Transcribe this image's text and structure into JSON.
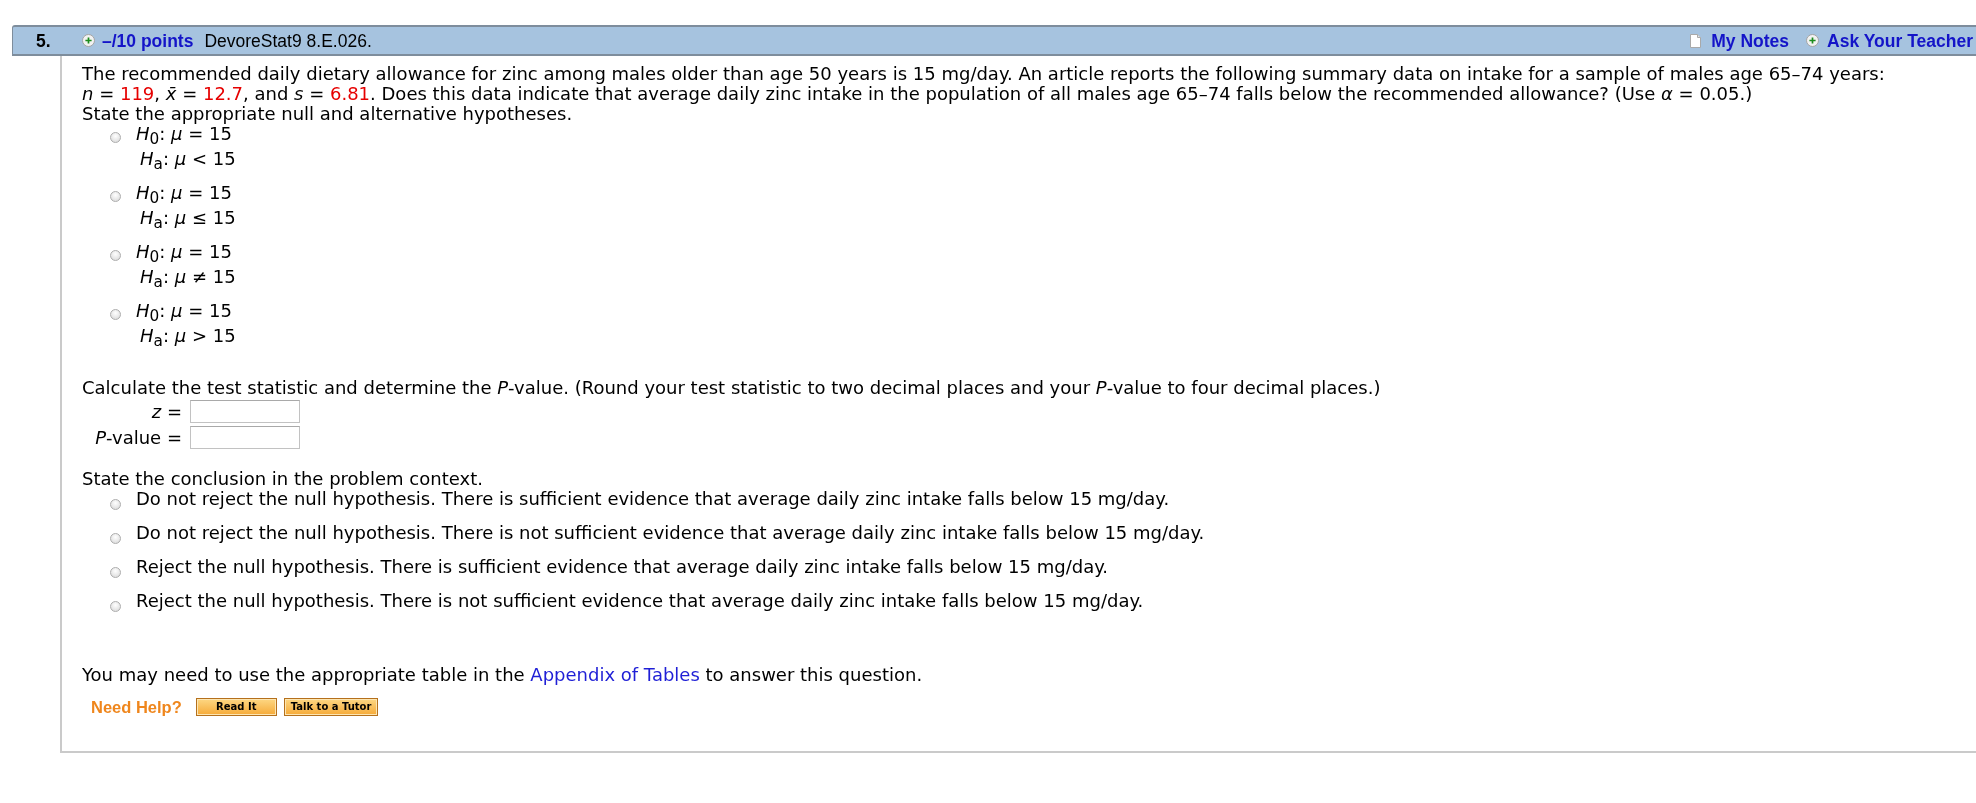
{
  "question": {
    "number": "5.",
    "points": "–/10 points",
    "source": "DevoreStat9 8.E.026.",
    "my_notes": "My Notes",
    "ask_teacher": "Ask Your Teacher"
  },
  "statement": [
    {
      "kind": "plain",
      "text": "The recommended daily dietary allowance for zinc among males older than age 50 years is 15 mg/day. An article reports the following summary data on intake for a sample of males age 65–74 years: *n* = "
    },
    {
      "kind": "given",
      "text": "119"
    },
    {
      "kind": "plain",
      "text": ", *x̄* = "
    },
    {
      "kind": "given",
      "text": "12.7"
    },
    {
      "kind": "plain",
      "text": ", and *s* = "
    },
    {
      "kind": "given",
      "text": "6.81"
    },
    {
      "kind": "plain",
      "text": ". Does this data indicate that average daily zinc intake in the population of all males age 65–74 falls below the recommended allowance? (Use *α* = 0.05.)"
    }
  ],
  "hypotheses": {
    "prompt": "State the appropriate null and alternative hypotheses.",
    "options": [
      {
        "null": "*H*$_{0}$: *μ* = 15",
        "alternative": "*H*$_{a}$: *μ* < 15",
        "selected": false
      },
      {
        "null": "*H*$_{0}$: *μ* = 15",
        "alternative": "*H*$_{a}$: *μ* ≤ 15",
        "selected": false
      },
      {
        "null": "*H*$_{0}$: *μ* = 15",
        "alternative": "*H*$_{a}$: *μ* ≠ 15",
        "selected": false
      },
      {
        "null": "*H*$_{0}$: *μ* = 15",
        "alternative": "*H*$_{a}$: *μ* > 15",
        "selected": false
      }
    ]
  },
  "test_statistic": {
    "prompt": "Calculate the test statistic and determine the *P*-value. (Round your test statistic to two decimal places and your *P*-value to four decimal places.)",
    "fields": [
      {
        "label": "*z* ="
      },
      {
        "label": "*P*-value ="
      }
    ]
  },
  "conclusion": {
    "prompt": "State the conclusion in the problem context.",
    "options": [
      {
        "text": "Do not reject the null hypothesis. There is sufficient evidence that average daily zinc intake falls below 15 mg/day.",
        "selected": false
      },
      {
        "text": "Do not reject the null hypothesis. There is not sufficient evidence that average daily zinc intake falls below 15 mg/day.",
        "selected": false
      },
      {
        "text": "Reject the null hypothesis. There is sufficient evidence that average daily zinc intake falls below 15 mg/day.",
        "selected": false
      },
      {
        "text": "Reject the null hypothesis. There is not sufficient evidence that average daily zinc intake falls below 15 mg/day.",
        "selected": false
      }
    ]
  },
  "appendix_note": {
    "before": "You may need to use the appropriate table in the",
    "link": "Appendix of Tables",
    "after": "to answer this question."
  },
  "help": {
    "label": "Need Help?",
    "buttons": [
      "Read It",
      "Talk to a Tutor"
    ]
  }
}
